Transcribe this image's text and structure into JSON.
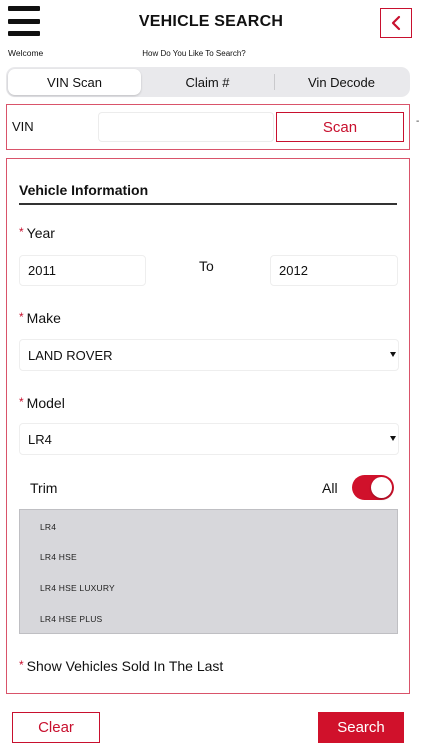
{
  "header": {
    "menu_icon": "hamburger-menu-icon",
    "welcome": "Welcome",
    "title": "VEHICLE SEARCH",
    "subtitle": "How Do You Like To Search?",
    "back_icon": "chevron-left-icon"
  },
  "tabs": [
    {
      "label": "VIN Scan",
      "active": true
    },
    {
      "label": "Claim #",
      "active": false
    },
    {
      "label": "Vin Decode",
      "active": false
    }
  ],
  "vin": {
    "label": "VIN",
    "value": "",
    "scan_label": "Scan",
    "side_mark": "-"
  },
  "vehicle_info": {
    "title": "Vehicle Information",
    "required_mark": "*",
    "year": {
      "label": "Year",
      "from": "2011",
      "to_label": "To",
      "to": "2012"
    },
    "make": {
      "label": "Make",
      "value": "LAND ROVER"
    },
    "model": {
      "label": "Model",
      "value": "LR4"
    },
    "trim": {
      "label": "Trim",
      "all_label": "All",
      "all_enabled": true,
      "items": [
        "LR4",
        "LR4 HSE",
        "LR4 HSE LUXURY",
        "LR4 HSE PLUS"
      ]
    },
    "sold_in_last_label": "Show Vehicles Sold In The Last"
  },
  "actions": {
    "clear_label": "Clear",
    "search_label": "Search"
  },
  "colors": {
    "accent": "#c8102e",
    "toggle_on": "#d0112b",
    "list_bg": "#d7d7db"
  }
}
